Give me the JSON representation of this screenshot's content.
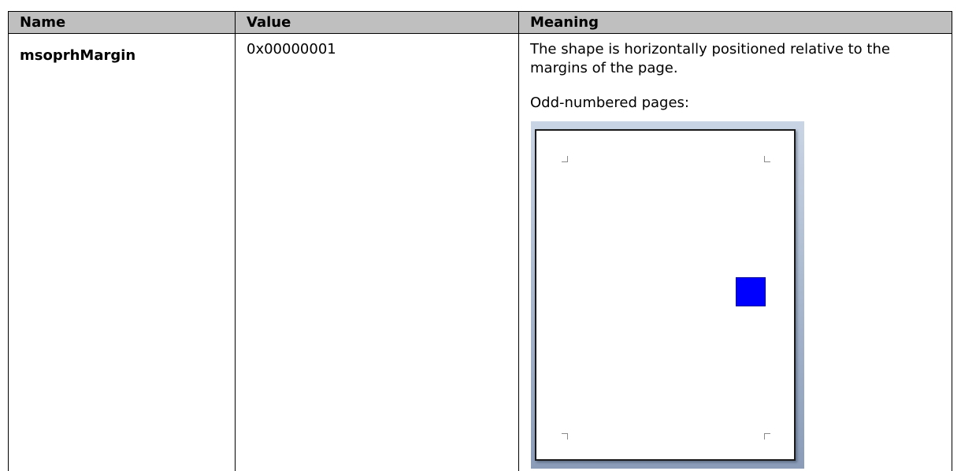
{
  "table": {
    "headers": {
      "name": "Name",
      "value": "Value",
      "meaning": "Meaning"
    },
    "rows": [
      {
        "name": "msoprhMargin",
        "value": "0x00000001",
        "meaning": "The shape is horizontally positioned relative to the margins of the page.",
        "figure_caption": "Odd-numbered pages:"
      }
    ]
  },
  "figure": {
    "shape_color": "#0000ff",
    "page_background": "#ffffff",
    "frame_gradient_top": "#c9d4e4",
    "frame_gradient_bottom": "#8a9cb8"
  }
}
